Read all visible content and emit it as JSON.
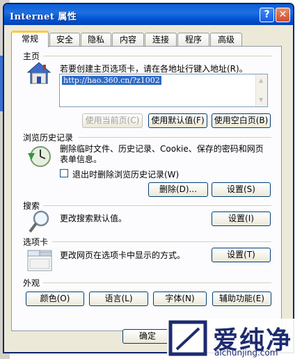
{
  "window": {
    "title": "Internet 属性"
  },
  "tabs": [
    "常规",
    "安全",
    "隐私",
    "内容",
    "连接",
    "程序",
    "高级"
  ],
  "home": {
    "label": "主页",
    "instruction": "若要创建主页选项卡，请在各地址行键入地址(R)。",
    "url": "http://hao.360.cn/?z1002",
    "btn_current": "使用当前页(C)",
    "btn_default": "使用默认值(F)",
    "btn_blank": "使用空白页(B)"
  },
  "history": {
    "label": "浏览历史记录",
    "desc": "删除临时文件、历史记录、Cookie、保存的密码和网页表单信息。",
    "checkbox_label": "退出时删除浏览历史记录(W)",
    "btn_delete": "删除(D)...",
    "btn_settings": "设置(S)"
  },
  "search": {
    "label": "搜索",
    "desc": "更改搜索默认值。",
    "btn_settings": "设置(I)"
  },
  "tabsection": {
    "label": "选项卡",
    "desc": "更改网页在选项卡中显示的方式。",
    "btn_settings": "设置(T)"
  },
  "appearance": {
    "label": "外观",
    "btn_colors": "颜色(O)",
    "btn_language": "语言(L)",
    "btn_fonts": "字体(N)",
    "btn_access": "辅助功能(E)"
  },
  "footer": {
    "btn_ok": "确定"
  },
  "watermark": {
    "brand_cn": "爱纯净",
    "brand_url": "aichunjing.com"
  }
}
